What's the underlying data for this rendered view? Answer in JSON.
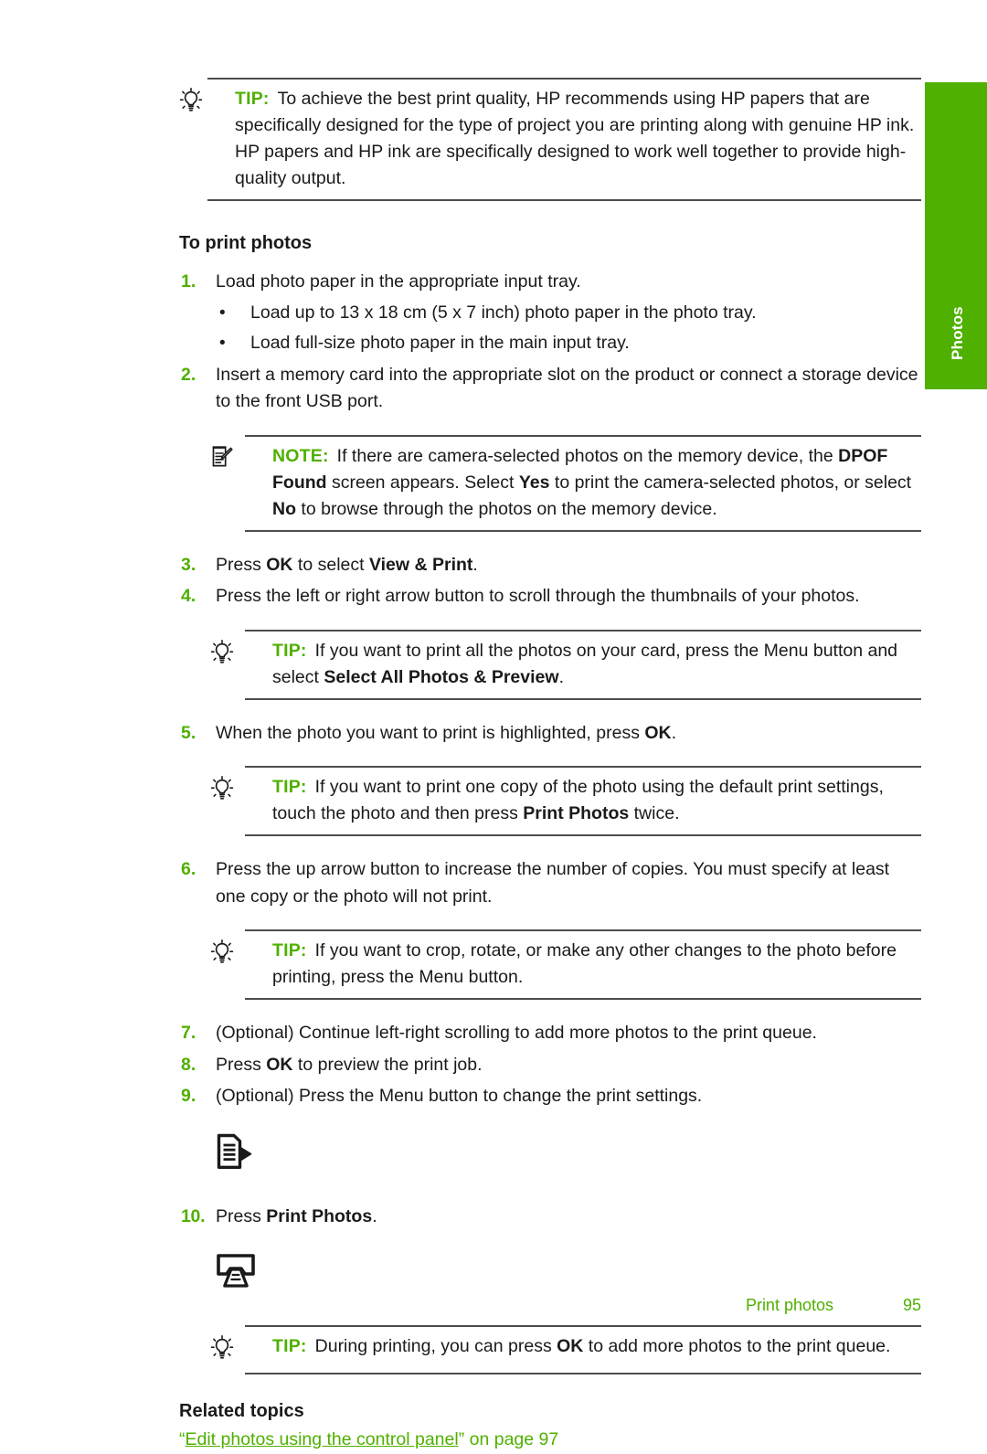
{
  "side_tab": {
    "label": "Photos",
    "color": "#4fb000"
  },
  "tip_top": {
    "keyword": "TIP:",
    "icon": "lightbulb-icon",
    "text": "To achieve the best print quality, HP recommends using HP papers that are specifically designed for the type of project you are printing along with genuine HP ink. HP papers and HP ink are specifically designed to work well together to provide high-quality output."
  },
  "section": {
    "heading": "To print photos"
  },
  "steps": {
    "s1": {
      "num": "1.",
      "text": "Load photo paper in the appropriate input tray."
    },
    "b1": {
      "dot": "•",
      "text": "Load up to 13 x 18 cm (5 x 7 inch) photo paper in the photo tray."
    },
    "b2": {
      "dot": "•",
      "text": "Load full-size photo paper in the main input tray."
    },
    "s2": {
      "num": "2.",
      "text": "Insert a memory card into the appropriate slot on the product or connect a storage device to the front USB port."
    },
    "s3": {
      "num": "3.",
      "pre": "Press ",
      "kw1": "OK",
      "mid": " to select ",
      "kw2": "View & Print",
      "post": "."
    },
    "s4": {
      "num": "4.",
      "text": "Press the left or right arrow button to scroll through the thumbnails of your photos."
    },
    "s5": {
      "num": "5.",
      "pre": "When the photo you want to print is highlighted, press ",
      "kw1": "OK",
      "post": "."
    },
    "s6": {
      "num": "6.",
      "text": "Press the up arrow button to increase the number of copies. You must specify at least one copy or the photo will not print."
    },
    "s7": {
      "num": "7.",
      "text": "(Optional) Continue left-right scrolling to add more photos to the print queue."
    },
    "s8": {
      "num": "8.",
      "pre": "Press ",
      "kw1": "OK",
      "post": " to preview the print job."
    },
    "s9": {
      "num": "9.",
      "text": "(Optional) Press the Menu button to change the print settings."
    },
    "s10": {
      "num": "10.",
      "pre": "Press ",
      "kw1": "Print Photos",
      "post": "."
    }
  },
  "note_dpof": {
    "keyword": "NOTE:",
    "icon": "note-pencil-icon",
    "p1": "If there are camera-selected photos on the memory device, the ",
    "b1": "DPOF Found",
    "p2": " screen appears. Select ",
    "b2": "Yes",
    "p3": " to print the camera-selected photos, or select ",
    "b3": "No",
    "p4": " to browse through the photos on the memory device."
  },
  "tip_select_all": {
    "keyword": "TIP:",
    "icon": "lightbulb-icon",
    "p1": "If you want to print all the photos on your card, press the Menu button and select ",
    "b1": "Select All Photos & Preview",
    "p2": "."
  },
  "tip_one_copy": {
    "keyword": "TIP:",
    "icon": "lightbulb-icon",
    "p1": "If you want to print one copy of the photo using the default print settings, touch the photo and then press ",
    "b1": "Print Photos",
    "p2": " twice."
  },
  "tip_crop": {
    "keyword": "TIP:",
    "icon": "lightbulb-icon",
    "p1": "If you want to crop, rotate, or make any other changes to the photo before printing, press the Menu button.",
    "b1": "",
    "p2": ""
  },
  "tip_during_print": {
    "keyword": "TIP:",
    "icon": "lightbulb-icon",
    "p1": "During printing, you can press ",
    "b1": "OK",
    "p2": " to add more photos to the print queue."
  },
  "control_icons": {
    "menu": "menu-button-icon",
    "print_photos": "print-photos-button-icon"
  },
  "related": {
    "heading": "Related topics",
    "open_quote": "“",
    "link_text": "Edit photos using the control panel",
    "close_quote": "”",
    "suffix": " on page 97"
  },
  "footer": {
    "title": "Print photos",
    "page": "95"
  }
}
